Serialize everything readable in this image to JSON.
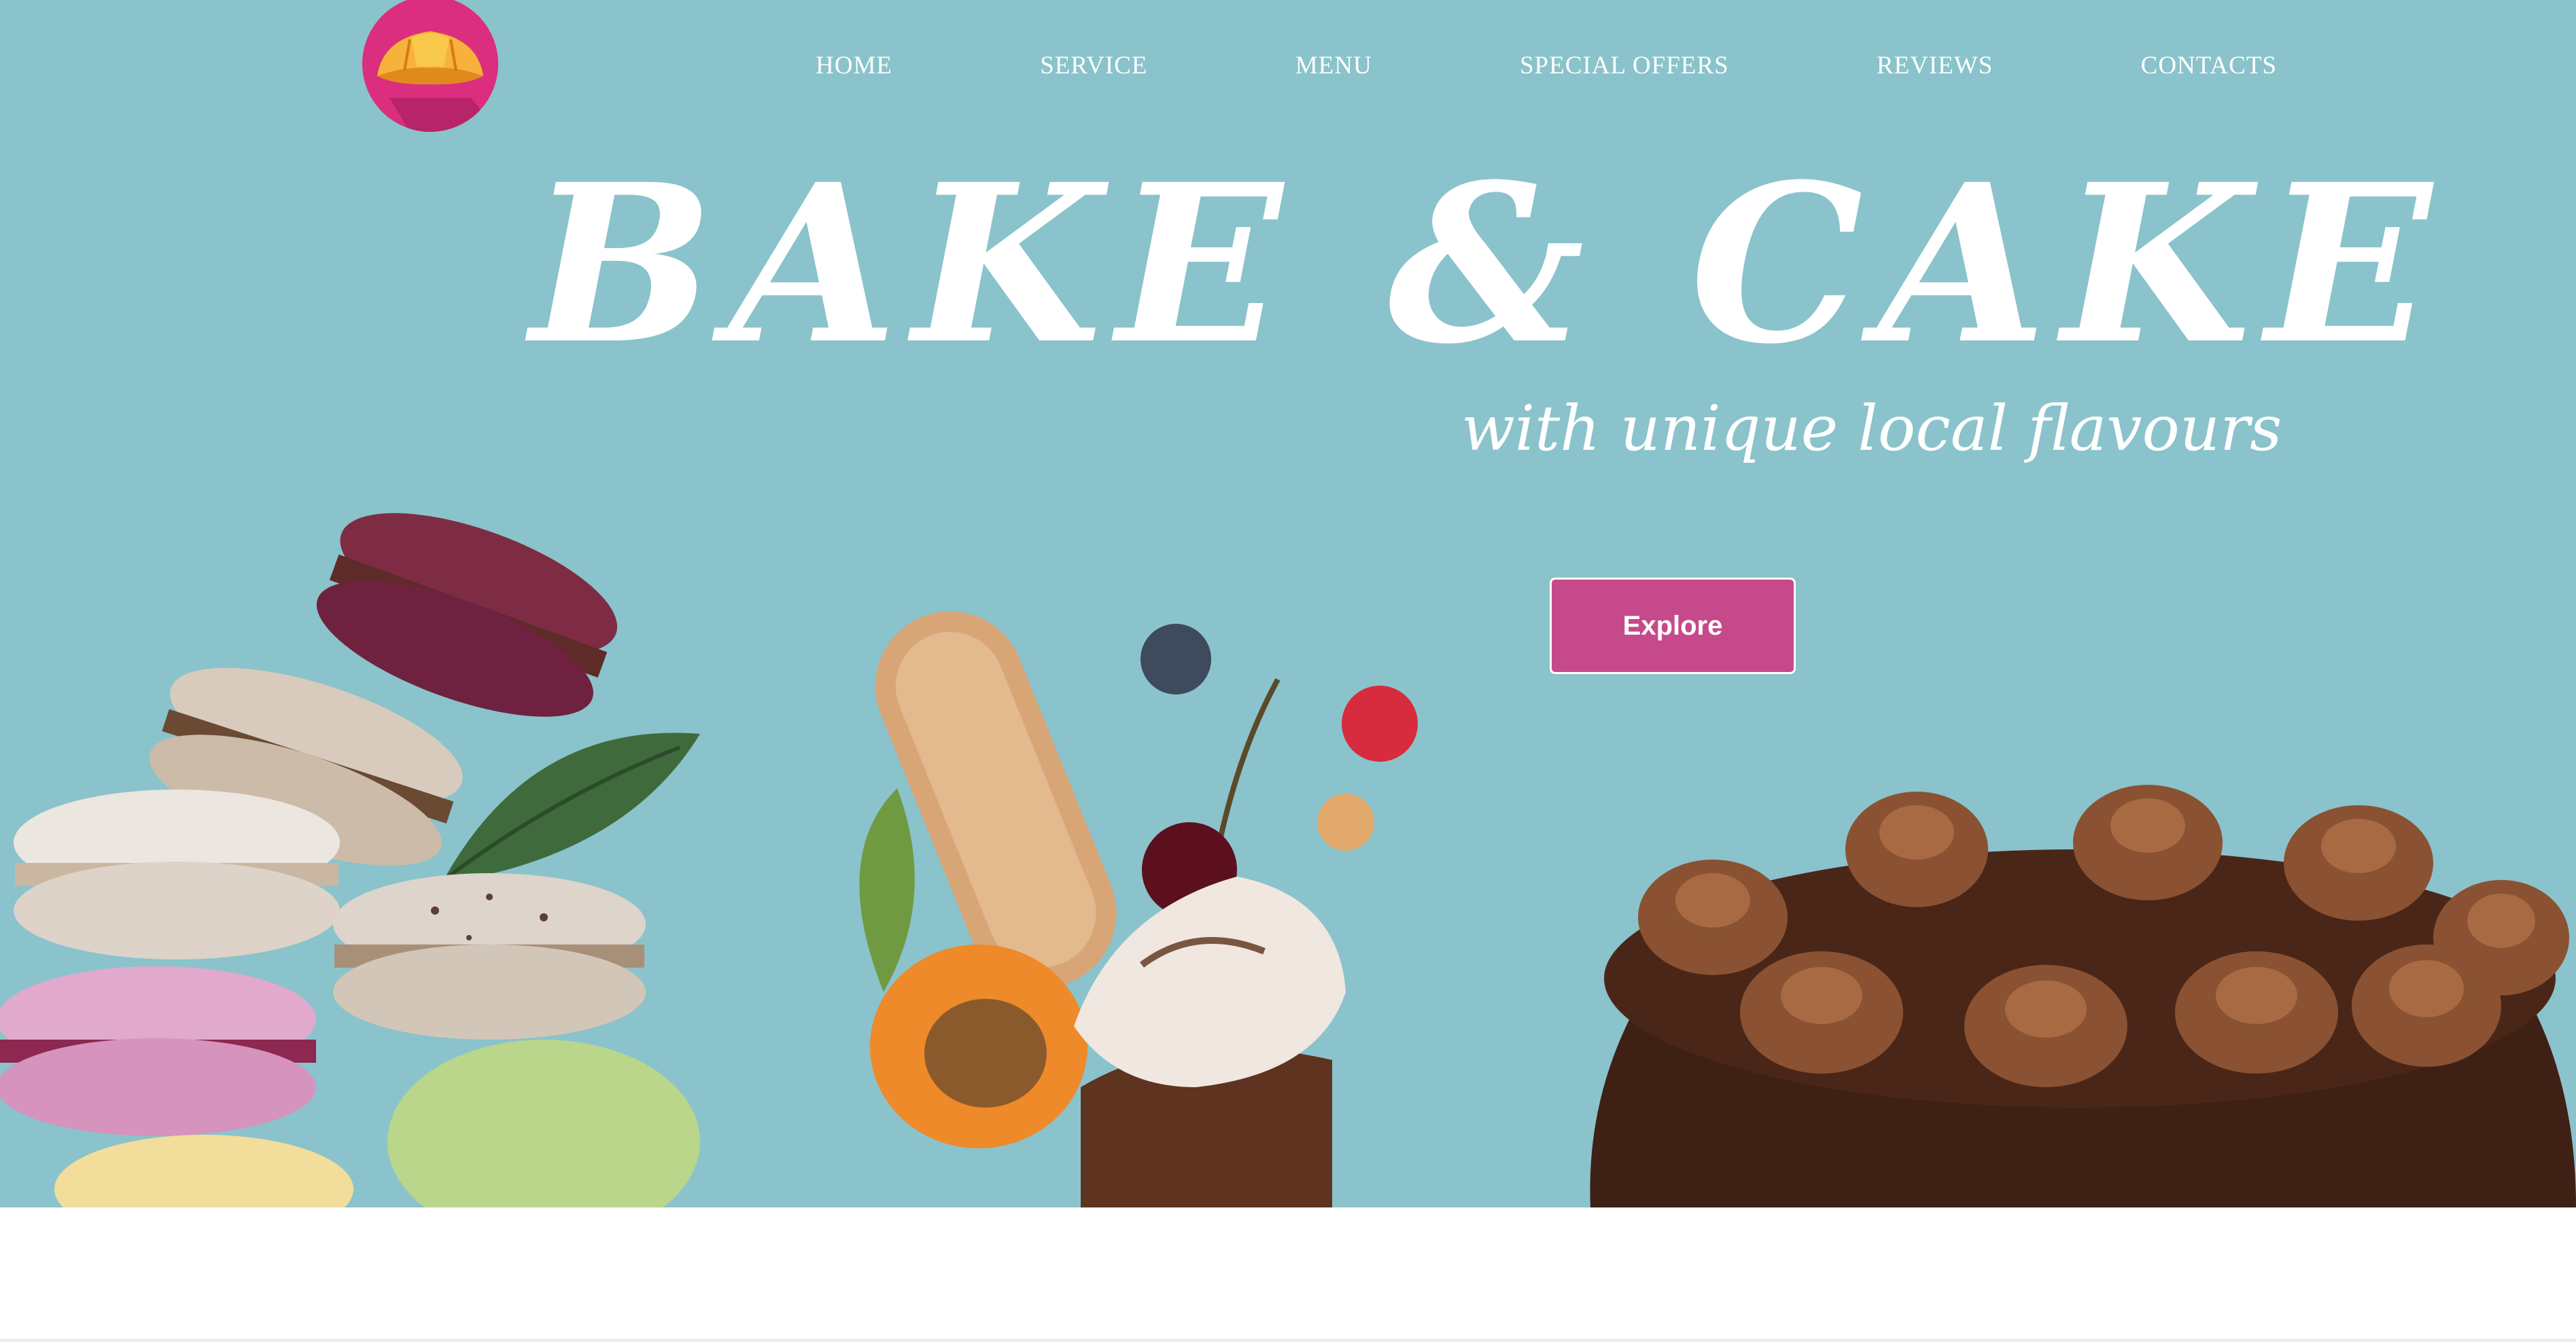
{
  "header": {
    "logo": {
      "icon": "croissant-icon",
      "background": "#db2e7e",
      "accent": "#f6b23a"
    },
    "nav": [
      {
        "label": "HOME"
      },
      {
        "label": "SERVICE"
      },
      {
        "label": "MENU"
      },
      {
        "label": "SPECIAL OFFERS"
      },
      {
        "label": "REVIEWS"
      },
      {
        "label": "CONTACTS"
      }
    ]
  },
  "hero": {
    "title": "BAKE & CAKE",
    "subtitle": "with unique local flavours",
    "cta_label": "Explore",
    "background": "#8ac3cb",
    "button_color": "#c64a8b",
    "images": [
      {
        "icon": "macarons-stack-image"
      },
      {
        "icon": "dessert-cream-fruit-image"
      },
      {
        "icon": "chocolate-cake-image"
      }
    ]
  }
}
